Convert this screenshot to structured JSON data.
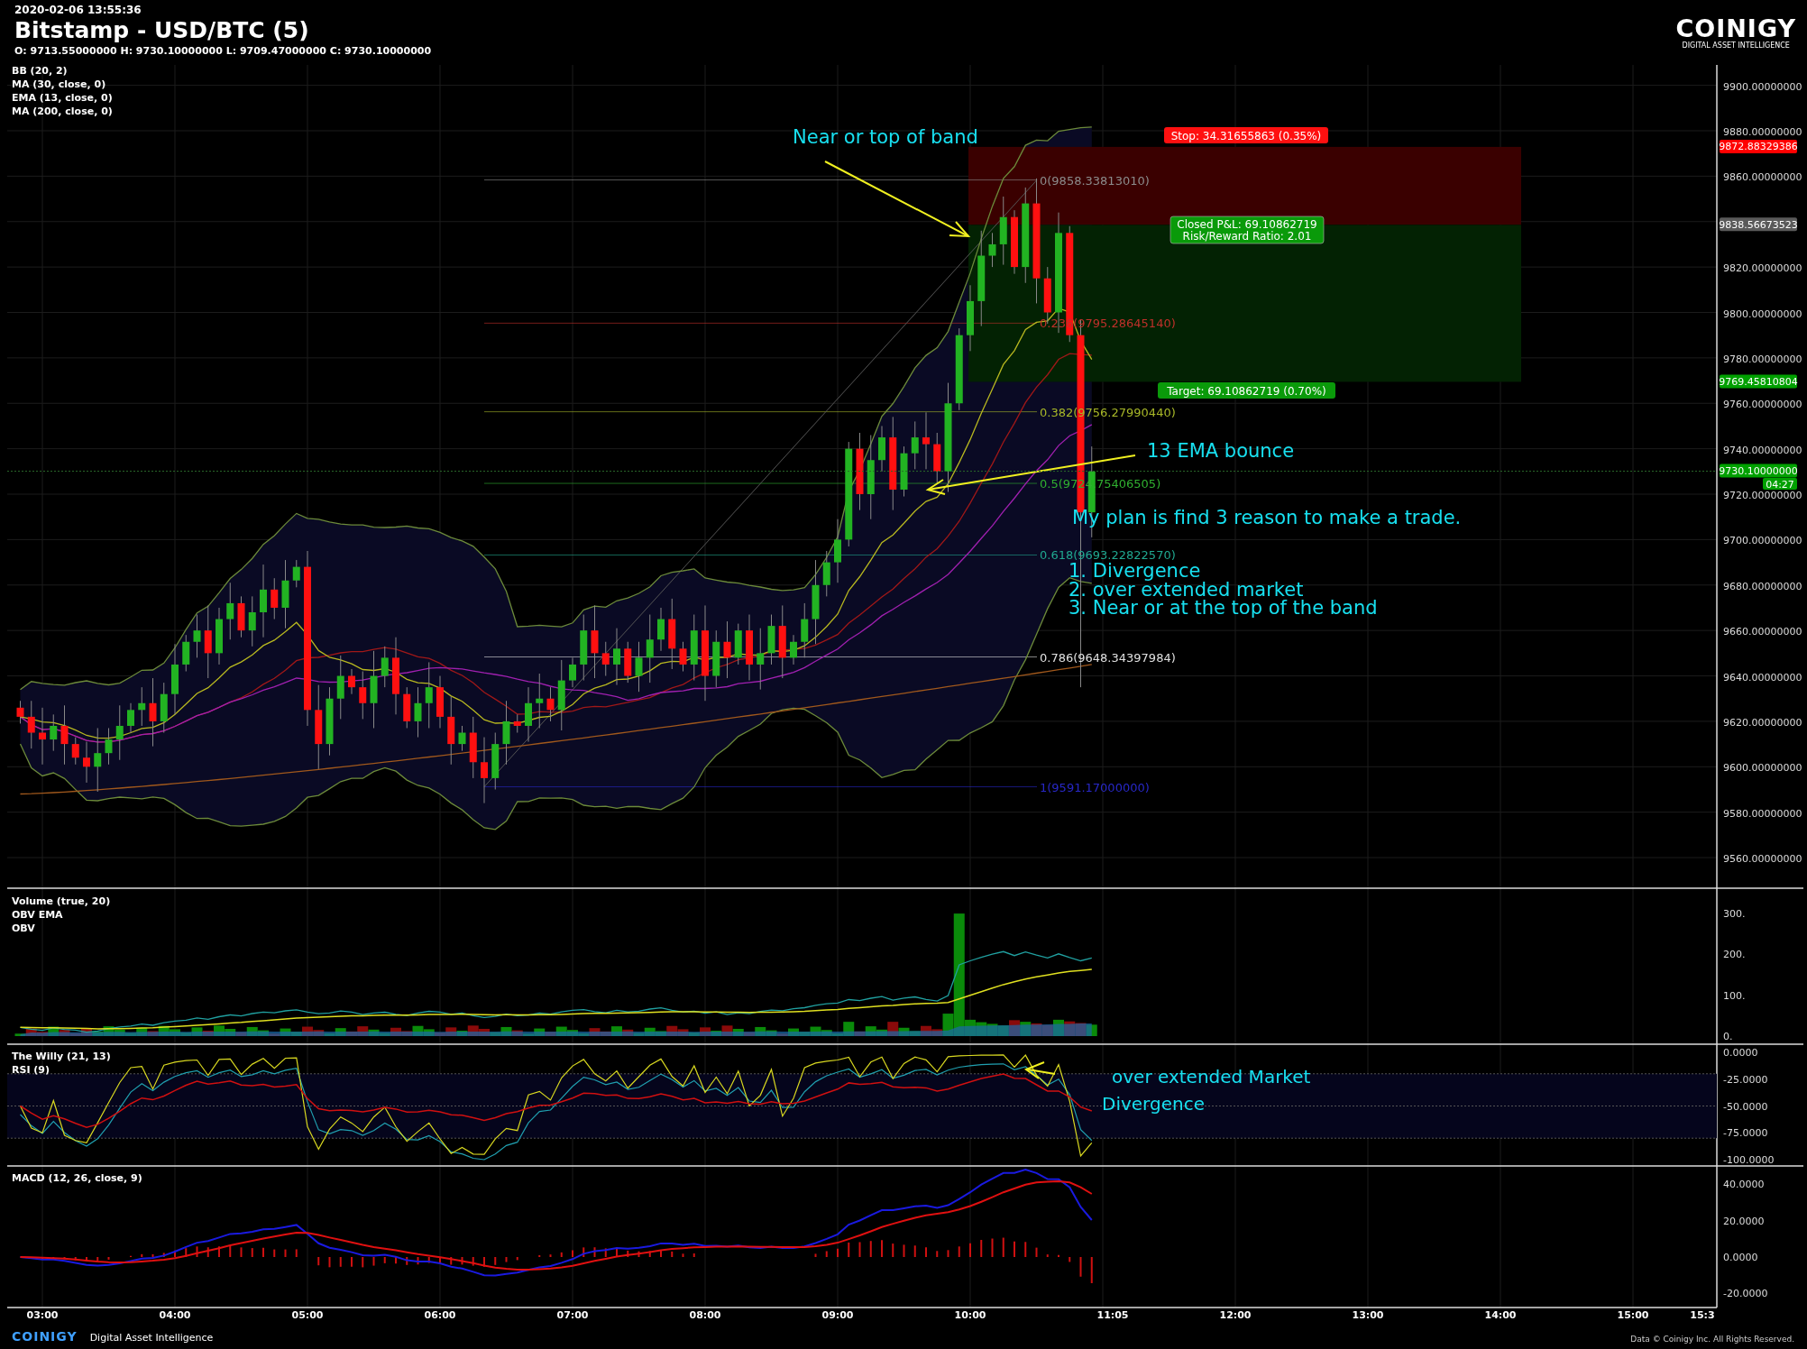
{
  "header": {
    "timestamp": "2020-02-06 13:55:36",
    "title": "Bitstamp - USD/BTC (5)",
    "ohlc": "O: 9713.55000000 H: 9730.10000000 L: 9709.47000000 C: 9730.10000000",
    "logo": "COINIGY",
    "tagline": "DIGITAL ASSET INTELLIGENCE"
  },
  "main_chart": {
    "indicators": [
      "BB (20, 2)",
      "MA (30, close, 0)",
      "EMA (13, close, 0)",
      "MA (200, close, 0)"
    ],
    "price_axis": [
      "9900.00000000",
      "9880.00000000",
      "9860.00000000",
      "9820.00000000",
      "9800.00000000",
      "9780.00000000",
      "9760.00000000",
      "9740.00000000",
      "9720.00000000",
      "9700.00000000",
      "9680.00000000",
      "9660.00000000",
      "9640.00000000",
      "9620.00000000",
      "9600.00000000",
      "9580.00000000",
      "9560.00000000"
    ],
    "price_tags": [
      {
        "text": "9872.88329386",
        "color": "#ff0000"
      },
      {
        "text": "9838.56673523",
        "color": "#5a5a5a"
      },
      {
        "text": "9769.45810804",
        "color": "#00a000"
      },
      {
        "text": "9730.10000000",
        "color": "#00a000"
      },
      {
        "text": "04:27",
        "color": "#00a000"
      }
    ],
    "fib_levels": [
      {
        "label": "0(9858.33813010)",
        "color": "#8c8c8c"
      },
      {
        "label": "0.236(9795.28645140)",
        "color": "#c0302a"
      },
      {
        "label": "0.382(9756.27990440)",
        "color": "#a8b828"
      },
      {
        "label": "0.5(9724.75406505)",
        "color": "#30b030"
      },
      {
        "label": "0.618(9693.22822570)",
        "color": "#20a890"
      },
      {
        "label": "0.786(9648.34397984)",
        "color": "#e0e0e0"
      },
      {
        "label": "1(9591.17000000)",
        "color": "#2828c8"
      }
    ],
    "trade": {
      "stop": "Stop: 34.31655863 (0.35%)",
      "result": [
        "Closed P&L: 69.10862719",
        "Risk/Reward Ratio: 2.01"
      ],
      "target": "Target: 69.10862719 (0.70%)"
    },
    "annotations": [
      "Near or top of band",
      "13 EMA bounce",
      "My plan is find 3 reason to make a trade.",
      "1. Divergence",
      "2. over extended market",
      "3. Near or at the top of the band"
    ]
  },
  "volume_panel": {
    "indicators": [
      "Volume (true, 20)",
      "OBV EMA",
      "OBV"
    ],
    "axis": [
      "300.",
      "200.",
      "100.",
      "0."
    ]
  },
  "willy_panel": {
    "indicators": [
      "The Willy (21, 13)",
      "RSI (9)"
    ],
    "axis": [
      "0.0000",
      "-25.0000",
      "-50.0000",
      "-75.0000",
      "-100.0000"
    ],
    "annotations": [
      "over extended Market",
      "Divergence"
    ]
  },
  "macd_panel": {
    "indicators": [
      "MACD (12, 26, close, 9)"
    ],
    "axis": [
      "40.0000",
      "20.0000",
      "0.0000",
      "-20.0000"
    ]
  },
  "time_axis": [
    "03:00",
    "04:00",
    "05:00",
    "06:00",
    "07:00",
    "08:00",
    "09:00",
    "10:00",
    "11:05",
    "12:00",
    "13:00",
    "14:00",
    "15:00",
    "15:3"
  ],
  "footer": {
    "logo": "COINIGY",
    "tagline": "Digital Asset Intelligence",
    "copyright": "Data © Coinigy Inc.  All Rights Reserved."
  }
}
